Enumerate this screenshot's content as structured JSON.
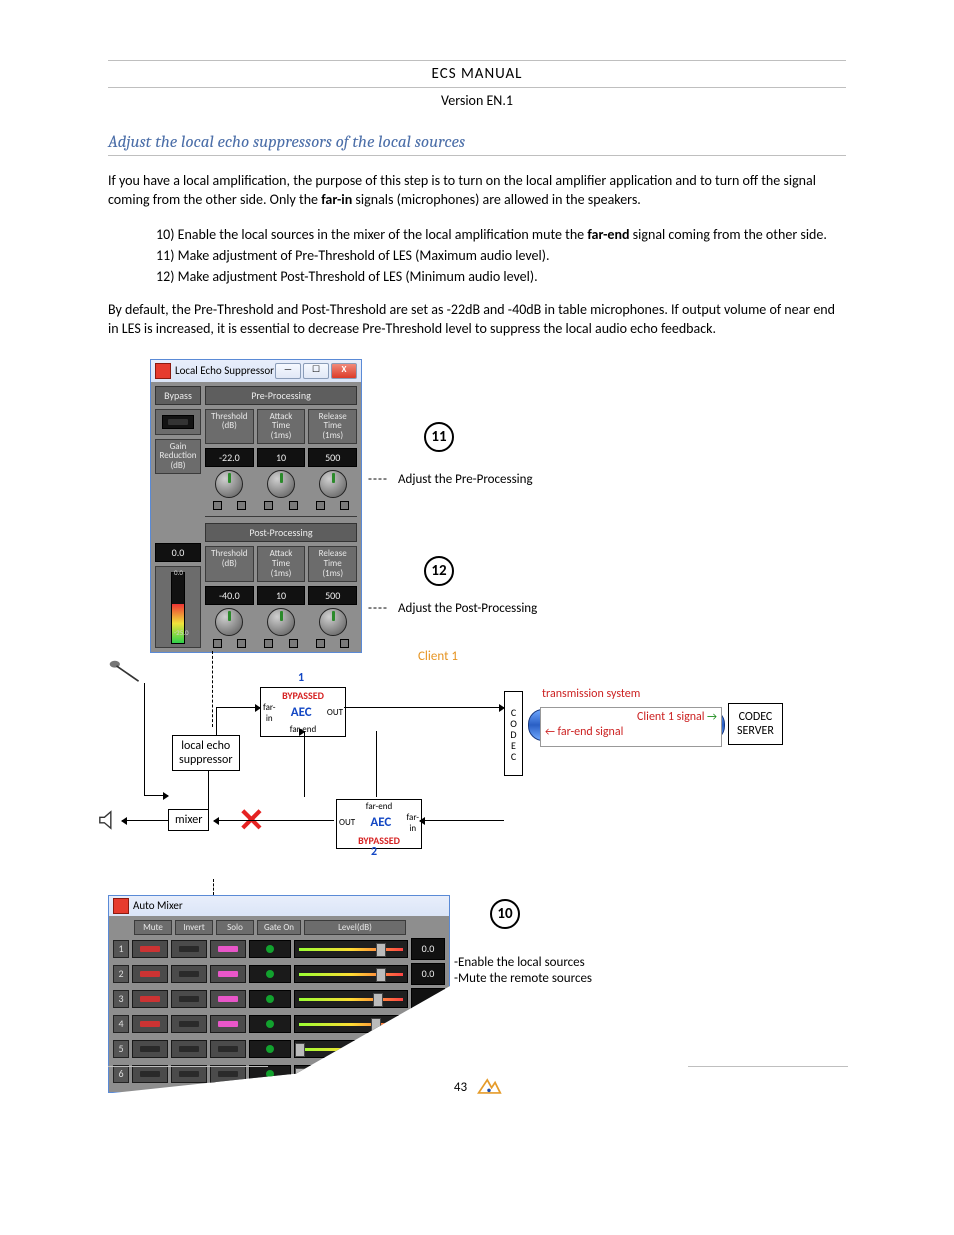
{
  "header": {
    "title": "ECS  MANUAL",
    "version": "Version EN.1"
  },
  "section_title": "Adjust the local echo suppressors of the local sources",
  "p1_a": "If you have a local amplification, the purpose of this step is to turn on the local amplifier application and to turn off the signal coming from the other side.  Only the ",
  "p1_bold1": "far-in",
  "p1_b": " signals (microphones) are allowed in the speakers.",
  "steps": {
    "s10_a": "10) Enable the local sources in the mixer of the local amplification mute the ",
    "s10_bold": "far-end",
    "s10_b": " signal coming from the other side.",
    "s11": "11) Make adjustment of Pre-Threshold of LES (Maximum audio level).",
    "s12": "12) Make adjustment Post-Threshold of LES (Minimum audio level)."
  },
  "p2": "By default, the Pre-Threshold and Post-Threshold are set as -22dB and -40dB in table microphones. If output volume of near end in LES is increased, it is essential to decrease Pre-Threshold level to suppress the local audio echo feedback.",
  "les_window": {
    "title": "Local Echo Suppressor",
    "bypass": "Bypass",
    "pre": "Pre-Processing",
    "post": "Post-Processing",
    "gain_reduction": "Gain\nReduction\n(dB)",
    "threshold": "Threshold\n(dB)",
    "attack": "Attack\nTime\n(1ms)",
    "release": "Release\nTime\n(1ms)",
    "pre_vals": {
      "threshold": "-22.0",
      "attack": "10",
      "release": "500"
    },
    "post_vals": {
      "threshold": "-40.0",
      "attack": "10",
      "release": "500"
    },
    "gain_val": "0.0",
    "meter_top": "0.0",
    "meter_bot": "-25.0"
  },
  "callouts": {
    "n11": "11",
    "t11": "Adjust the Pre-Processing",
    "n12": "12",
    "t12": "Adjust the Post-Processing",
    "n10": "10",
    "t10a": "-Enable the local sources",
    "t10b": "-Mute the remote sources",
    "dash": "----"
  },
  "diagram": {
    "client1": "Client 1",
    "num1": "1",
    "num2": "2",
    "bypassed": "BYPASSED",
    "aec": "AEC",
    "out": "OUT",
    "in": "in",
    "far_in": "far-\nin",
    "far_end": "far-end",
    "far_in2": "far-\nin",
    "les_box": "local echo\nsuppressor",
    "mixer": "mixer",
    "codec": "CODEC",
    "trans": "transmission system",
    "codec_server": "CODEC\nSERVER",
    "sig1": "Client 1 signal",
    "sig2": "far-end signal"
  },
  "automixer": {
    "title": "Auto Mixer",
    "cols": {
      "mute": "Mute",
      "invert": "Invert",
      "solo": "Solo",
      "gate": "Gate On",
      "level": "Level(dB)"
    },
    "rows": [
      {
        "n": "1",
        "mute": true,
        "solo": true,
        "val": "0.0",
        "thumb": 72
      },
      {
        "n": "2",
        "mute": true,
        "solo": true,
        "val": "0.0",
        "thumb": 72
      },
      {
        "n": "3",
        "mute": true,
        "solo": true,
        "val": "",
        "thumb": 70
      },
      {
        "n": "4",
        "mute": true,
        "solo": true,
        "val": "",
        "thumb": 68
      },
      {
        "n": "5",
        "mute": false,
        "solo": false,
        "val": "",
        "thumb": 0
      },
      {
        "n": "6",
        "mute": false,
        "solo": false,
        "val": "",
        "thumb": 0
      }
    ]
  },
  "page_number": "43"
}
